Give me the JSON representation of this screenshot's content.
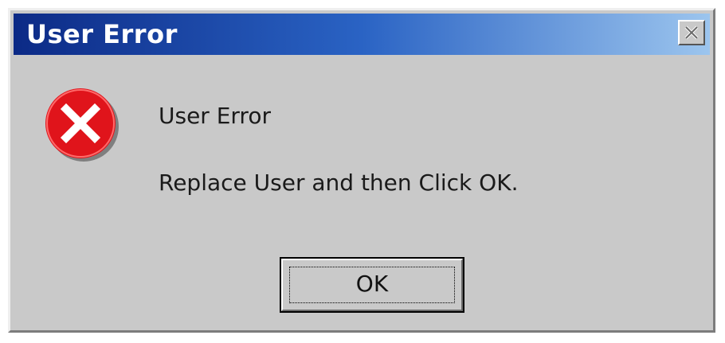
{
  "window": {
    "title": "User Error"
  },
  "titlebar": {
    "close_icon": "close-icon"
  },
  "message": {
    "icon": "error-icon",
    "line1": "User Error",
    "line2": "Replace User and then Click OK."
  },
  "buttons": {
    "ok_label": "OK"
  },
  "colors": {
    "titlebar_start": "#0c2a86",
    "titlebar_end": "#9cc5ee",
    "dialog_bg": "#c9c9c9",
    "error_red": "#e0141b"
  }
}
